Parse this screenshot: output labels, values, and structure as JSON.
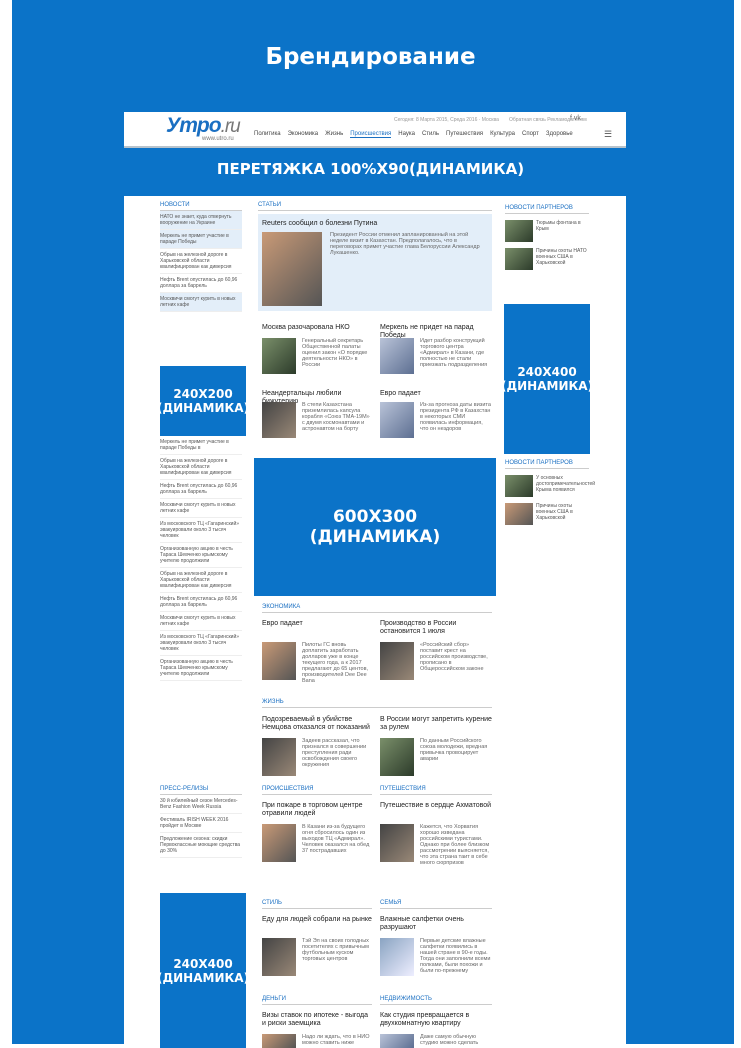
{
  "title": "Брендирование",
  "header": {
    "logo": "Утро",
    "logo_suffix": ".ru",
    "logo_url": "www.utro.ru",
    "date": "Сегодня: 8 Марта 2015, Среда 2016 · Москва",
    "links": "Обратная связь   Рекламодателям",
    "social": "f  vk",
    "nav": [
      "Политика",
      "Экономика",
      "Жизнь",
      "Происшествия",
      "Наука",
      "Стиль",
      "Путешествия",
      "Культура",
      "Спорт",
      "Здоровье"
    ],
    "active": "Происшествия"
  },
  "strip": "ПЕРЕТЯЖКА 100%X90(ДИНАМИКА)",
  "banners": {
    "b1": "240X200\n(ДИНАМИКА)",
    "b2": "240X400\n(ДИНАМИКА)",
    "b3": "600X300\n(ДИНАМИКА)",
    "b4": "240X400\n(ДИНАМИКА)"
  },
  "news": {
    "title": "НОВОСТИ",
    "items": [
      "НАТО не знает, куда отвернуть вооружение на Украине",
      "Меркель не примет участие в параде Победы",
      "Обрыв на железной дороге в Харьковской области квалифицирован как диверсия",
      "Нефть Brent опустилась до 60,96 доллара за баррель",
      "Москвичи смогут курить в новых летних кафе"
    ],
    "items2": [
      "Меркель не примет участие в параде Победы в",
      "Обрыв на железной дороге в Харьковской области квалифицирован как диверсия",
      "Нефть Brent опустилась до 60,96 доллара за баррель",
      "Москвичи смогут курить в новых летних кафе",
      "Из московского ТЦ «Гагаринский» эвакуировали около 3 тысяч человек",
      "Организованную акцию в честь Тараса Шевченко крымскому учителю продолжили",
      "Обрыв на железной дороге в Харьковской области квалифицирован как диверсия",
      "Нефть Brent опустилась до 60,96 доллара за баррель",
      "Москвичи смогут курить в новых летних кафе",
      "Из московского ТЦ «Гагаринский» эвакуировали около 3 тысяч человек",
      "Организованную акцию в честь Тараса Шевченко крымскому учителю продолжили"
    ]
  },
  "press": {
    "title": "ПРЕСС-РЕЛИЗЫ",
    "items": [
      "30 й юбилейный сезон Mercedes-Benz Fashion Week Russia",
      "Фестиваль IRISH WEEK 2016 пройдет в Москве",
      "Предложение сезона: скидки Первоклассные моющие средства до 30%"
    ]
  },
  "articles": {
    "section": "СТАТЬИ",
    "top_title": "Reuters сообщил о болезни Путина",
    "top_text": "Президент России отменил запланированный на этой неделе визит в Казахстан. Предполагалось, что в переговорах примет участие глава Белоруссии Александр Лукашенко.",
    "a1_title": "Москва разочаровала НКО",
    "a1_text": "Генеральный секретарь Общественной палаты оценил закон «О порядке деятельности НКО» в России",
    "a2_title": "Меркель не придет на парад Победы",
    "a2_text": "Идет разбор конструкций торгового центра «Адмирал» в Казани, где полностью не стали приезжать подразделения",
    "a3_title": "Неандертальцы любили бижутерию",
    "a3_text": "В степи Казахстана приземлилась капсула корабля «Союз ТМА-19М» с двумя космонавтами и астронавтом на борту",
    "a4_title": "Евро падает",
    "a4_text": "Из-за прогноза даты визита президента РФ в Казахстан в некоторых СМИ появилась информация, что он нездоров"
  },
  "economy": {
    "section": "ЭКОНОМИКА",
    "t1": "Евро падает",
    "x1": "Пилоты ГС вновь доплатить заработать долларов уже в конце текущего года, а к 2017 предлагают до 65 центов, производителей Dee Dee Bana",
    "t2": "Производство в России остановится 1 июля",
    "x2": "«Российский сбор» поставит крест на российском производстве, прописано в Общероссийском законе"
  },
  "life": {
    "section": "ЖИЗНЬ",
    "t1": "Подозреваемый в убийстве Немцова отказался от показаний",
    "x1": "Задеев рассказал, что признался в совершении преступления ради освобождения своего окружения",
    "t2": "В России могут запретить курение за рулем",
    "x2": "По данным Российского союза молодежи, вредная привычка провоцирует аварии"
  },
  "incidents": {
    "section": "ПРОИСШЕСТВИЯ",
    "t1": "При пожаре в торговом центре отравили людей",
    "x1": "В Казани из-за будущего огня сбросилось один из выходов ТЦ «Адмирал». Человек оказался на обед 37 пострадавших"
  },
  "travel": {
    "section": "ПУТЕШЕСТВИЯ",
    "t1": "Путешествие в сердце Ахматовой",
    "x1": "Кажется, что Хорватия хорошо изведана российскими туристами. Однако при более близком рассмотрении выясняется, что эта страна таит в себе много сюрпризов"
  },
  "style": {
    "section": "СТИЛЬ",
    "t1": "Еду для людей собрали на рынке",
    "x1": "Тэй Эл на своих голодных посетителях с привычным футбольным куском торговых центров"
  },
  "family": {
    "section": "СЕМЬЯ",
    "t1": "Влажные салфетки очень разрушают",
    "x1": "Первые детские влажные салфетки появились в нашей стране в 90-е годы. Тогда они заполнили всеми полками, были похожи и были по-прежнему"
  },
  "money": {
    "section": "ДЕНЬГИ",
    "t1": "Визы ставок по ипотеке - выгода и риски заемщика",
    "x1": "Надо ли ждать, что в НИО можно ставить ниже"
  },
  "realty": {
    "section": "НЕДВИЖИМОСТЬ",
    "t1": "Как студия превращается в двухкомнатную квартиру",
    "x1": "Даже самую обычную студию можно сделать"
  },
  "partners": {
    "title": "НОВОСТИ ПАРТНЕРОВ",
    "items": [
      "Тюрьмы фонтана в Крым",
      "Причины охоты НАТО военных США в Харьковской"
    ],
    "title2": "НОВОСТИ ПАРТНЕРОВ",
    "items2": [
      "У основных достопримечательностей Крыма появился",
      "Причины охоты военных США в Харьковской"
    ]
  }
}
